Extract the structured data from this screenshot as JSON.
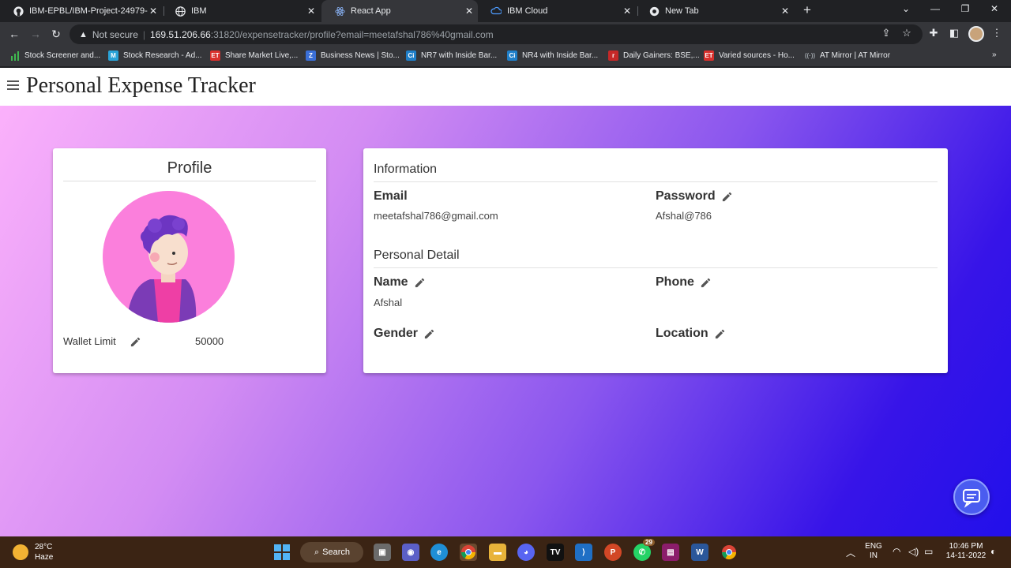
{
  "browser": {
    "tabs": [
      {
        "title": "IBM-EPBL/IBM-Project-24979-16",
        "icon": "github-icon"
      },
      {
        "title": "IBM",
        "icon": "globe-icon"
      },
      {
        "title": "React App",
        "icon": "react-icon"
      },
      {
        "title": "IBM Cloud",
        "icon": "cloud-icon"
      },
      {
        "title": "New Tab",
        "icon": "chrome-icon"
      }
    ],
    "security_label": "Not secure",
    "url_host": "169.51.206.66",
    "url_path": ":31820/expensetracker/profile?email=meetafshal786%40gmail.com",
    "bookmarks": [
      {
        "label": "Stock Screener and...",
        "icon": "bars-icon",
        "color": "#3fb950"
      },
      {
        "label": "Stock Research - Ad...",
        "icon": "m-icon",
        "color": "#2aa3d8"
      },
      {
        "label": "Share Market Live,...",
        "icon": "et-icon",
        "color": "#d9302c"
      },
      {
        "label": "Business News | Sto...",
        "icon": "z-icon",
        "color": "#3a6fd8"
      },
      {
        "label": "NR7 with Inside Bar...",
        "icon": "ci-icon",
        "color": "#1f7fc9"
      },
      {
        "label": "NR4 with Inside Bar...",
        "icon": "ci-icon",
        "color": "#1f7fc9"
      },
      {
        "label": "Daily Gainers: BSE,...",
        "icon": "r-icon",
        "color": "#c62828"
      },
      {
        "label": "Varied sources - Ho...",
        "icon": "et-icon",
        "color": "#d9302c"
      },
      {
        "label": "AT Mirror | AT Mirror",
        "icon": "signal-icon",
        "color": "#9aa0a6"
      }
    ]
  },
  "app": {
    "title": "Personal Expense Tracker",
    "profile": {
      "heading": "Profile",
      "wallet_label": "Wallet Limit",
      "wallet_value": "50000"
    },
    "information": {
      "heading": "Information",
      "email_label": "Email",
      "email_value": "meetafshal786@gmail.com",
      "password_label": "Password",
      "password_value": "Afshal@786"
    },
    "personal_detail": {
      "heading": "Personal Detail",
      "name_label": "Name",
      "name_value": "Afshal",
      "phone_label": "Phone",
      "gender_label": "Gender",
      "location_label": "Location"
    }
  },
  "taskbar": {
    "temperature": "28°C",
    "weather": "Haze",
    "search_label": "Search",
    "whatsapp_badge": "29",
    "lang_top": "ENG",
    "lang_bottom": "IN",
    "time": "10:46 PM",
    "date": "14-11-2022"
  }
}
